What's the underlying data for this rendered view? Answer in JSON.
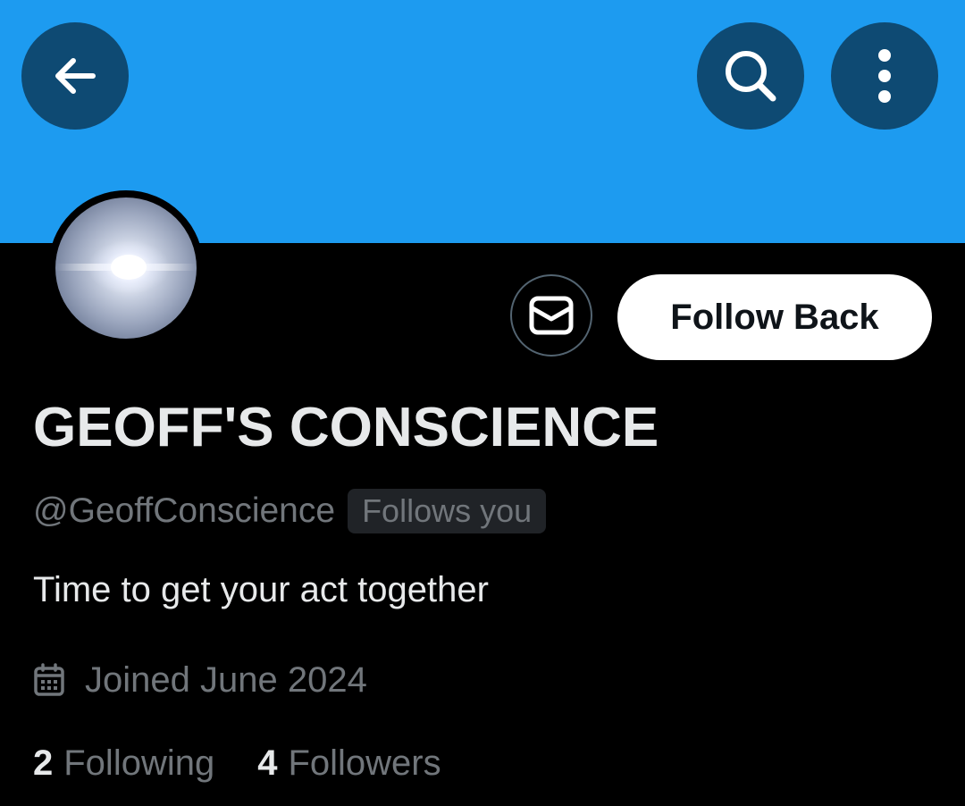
{
  "colors": {
    "banner": "#1d9bf0",
    "header_button_bg": "#0e4a73",
    "background": "#000000",
    "primary_text": "#e7e9ea",
    "secondary_text": "#71767b",
    "follow_button_bg": "#ffffff",
    "follow_button_text": "#0f1419",
    "badge_bg": "#202327"
  },
  "header": {
    "back_icon": "arrow-left-icon",
    "search_icon": "search-icon",
    "more_icon": "more-vertical-icon"
  },
  "profile": {
    "avatar_icon": "lens-flare-avatar",
    "display_name": "GEOFF'S CONSCIENCE",
    "handle": "@GeoffConscience",
    "follows_you_badge": "Follows you",
    "bio": "Time to get your act together",
    "joined": "Joined June 2024",
    "joined_icon": "calendar-icon"
  },
  "actions": {
    "message_icon": "envelope-icon",
    "follow_back_label": "Follow Back"
  },
  "stats": {
    "following_count": "2",
    "following_label": "Following",
    "followers_count": "4",
    "followers_label": "Followers"
  }
}
